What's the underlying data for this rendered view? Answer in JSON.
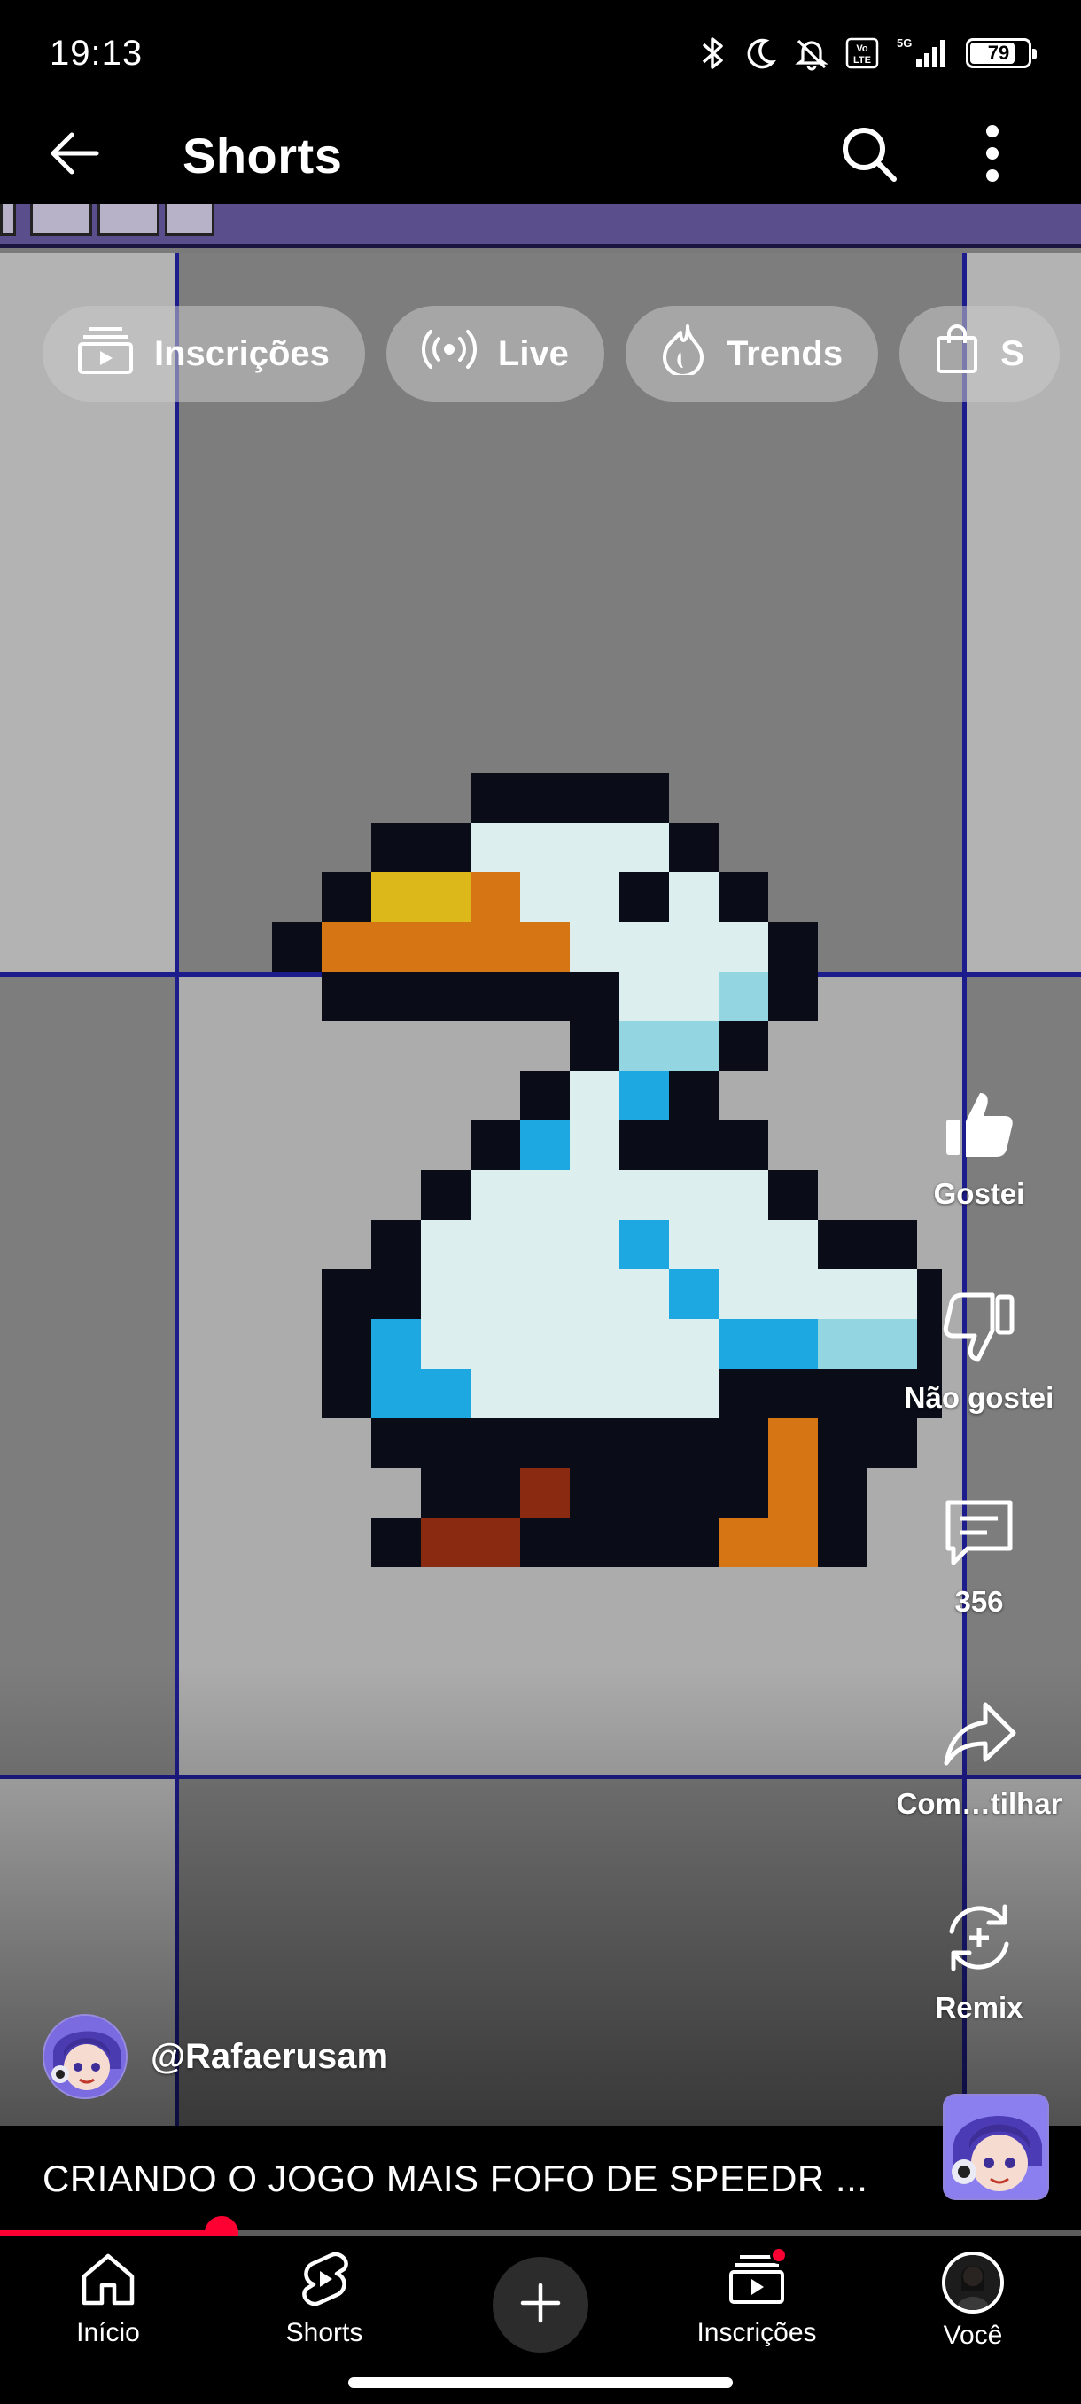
{
  "status_bar": {
    "time": "19:13",
    "battery_percent": 79,
    "battery_label": "79",
    "network_label": "5G",
    "volte_label": "Vo LTE",
    "icons": [
      "bluetooth-icon",
      "moon-icon",
      "bell-off-icon",
      "volte-icon",
      "signal-icon",
      "battery-icon"
    ]
  },
  "app_bar": {
    "title": "Shorts",
    "back_icon": "arrow-left-icon",
    "search_icon": "search-icon",
    "menu_icon": "more-vert-icon"
  },
  "chips": [
    {
      "label": "Inscrições",
      "icon": "subscriptions-icon"
    },
    {
      "label": "Live",
      "icon": "live-icon"
    },
    {
      "label": "Trends",
      "icon": "flame-icon"
    },
    {
      "label": "S",
      "icon": "shopping-bag-icon"
    }
  ],
  "actions": {
    "like_label": "Gostei",
    "dislike_label": "Não gostei",
    "comments_label": "356",
    "share_label": "Com…tilhar",
    "remix_label": "Remix"
  },
  "channel": {
    "handle": "@Rafaerusam"
  },
  "video": {
    "title": "CRIANDO O JOGO MAIS FOFO DE SPEEDR ...",
    "progress": 0.205
  },
  "bottom_nav": {
    "home_label": "Início",
    "shorts_label": "Shorts",
    "subscriptions_label": "Inscrições",
    "you_label": "Você"
  },
  "colors": {
    "accent": "#ff0033",
    "background": "#000000",
    "chip_bg": "rgba(200,200,200,0.55)"
  }
}
